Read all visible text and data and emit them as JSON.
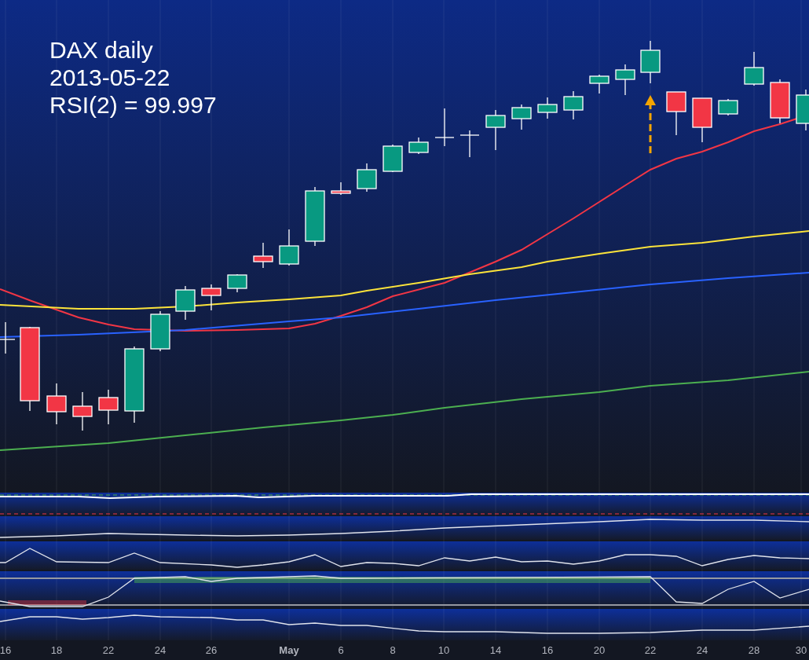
{
  "title": {
    "lines": [
      "DAX daily",
      "2013-05-22",
      "RSI(2) = 99.997"
    ]
  },
  "x_axis": {
    "labels": [
      {
        "text": "16",
        "kind": "day"
      },
      {
        "text": "18",
        "kind": "day"
      },
      {
        "text": "22",
        "kind": "day"
      },
      {
        "text": "24",
        "kind": "day"
      },
      {
        "text": "26",
        "kind": "day"
      },
      {
        "text": "May",
        "kind": "month"
      },
      {
        "text": "6",
        "kind": "day"
      },
      {
        "text": "8",
        "kind": "day"
      },
      {
        "text": "10",
        "kind": "day"
      },
      {
        "text": "14",
        "kind": "day"
      },
      {
        "text": "16",
        "kind": "day"
      },
      {
        "text": "20",
        "kind": "day"
      },
      {
        "text": "22",
        "kind": "day"
      },
      {
        "text": "24",
        "kind": "day"
      },
      {
        "text": "28",
        "kind": "day"
      },
      {
        "text": "30",
        "kind": "day"
      }
    ]
  }
}
